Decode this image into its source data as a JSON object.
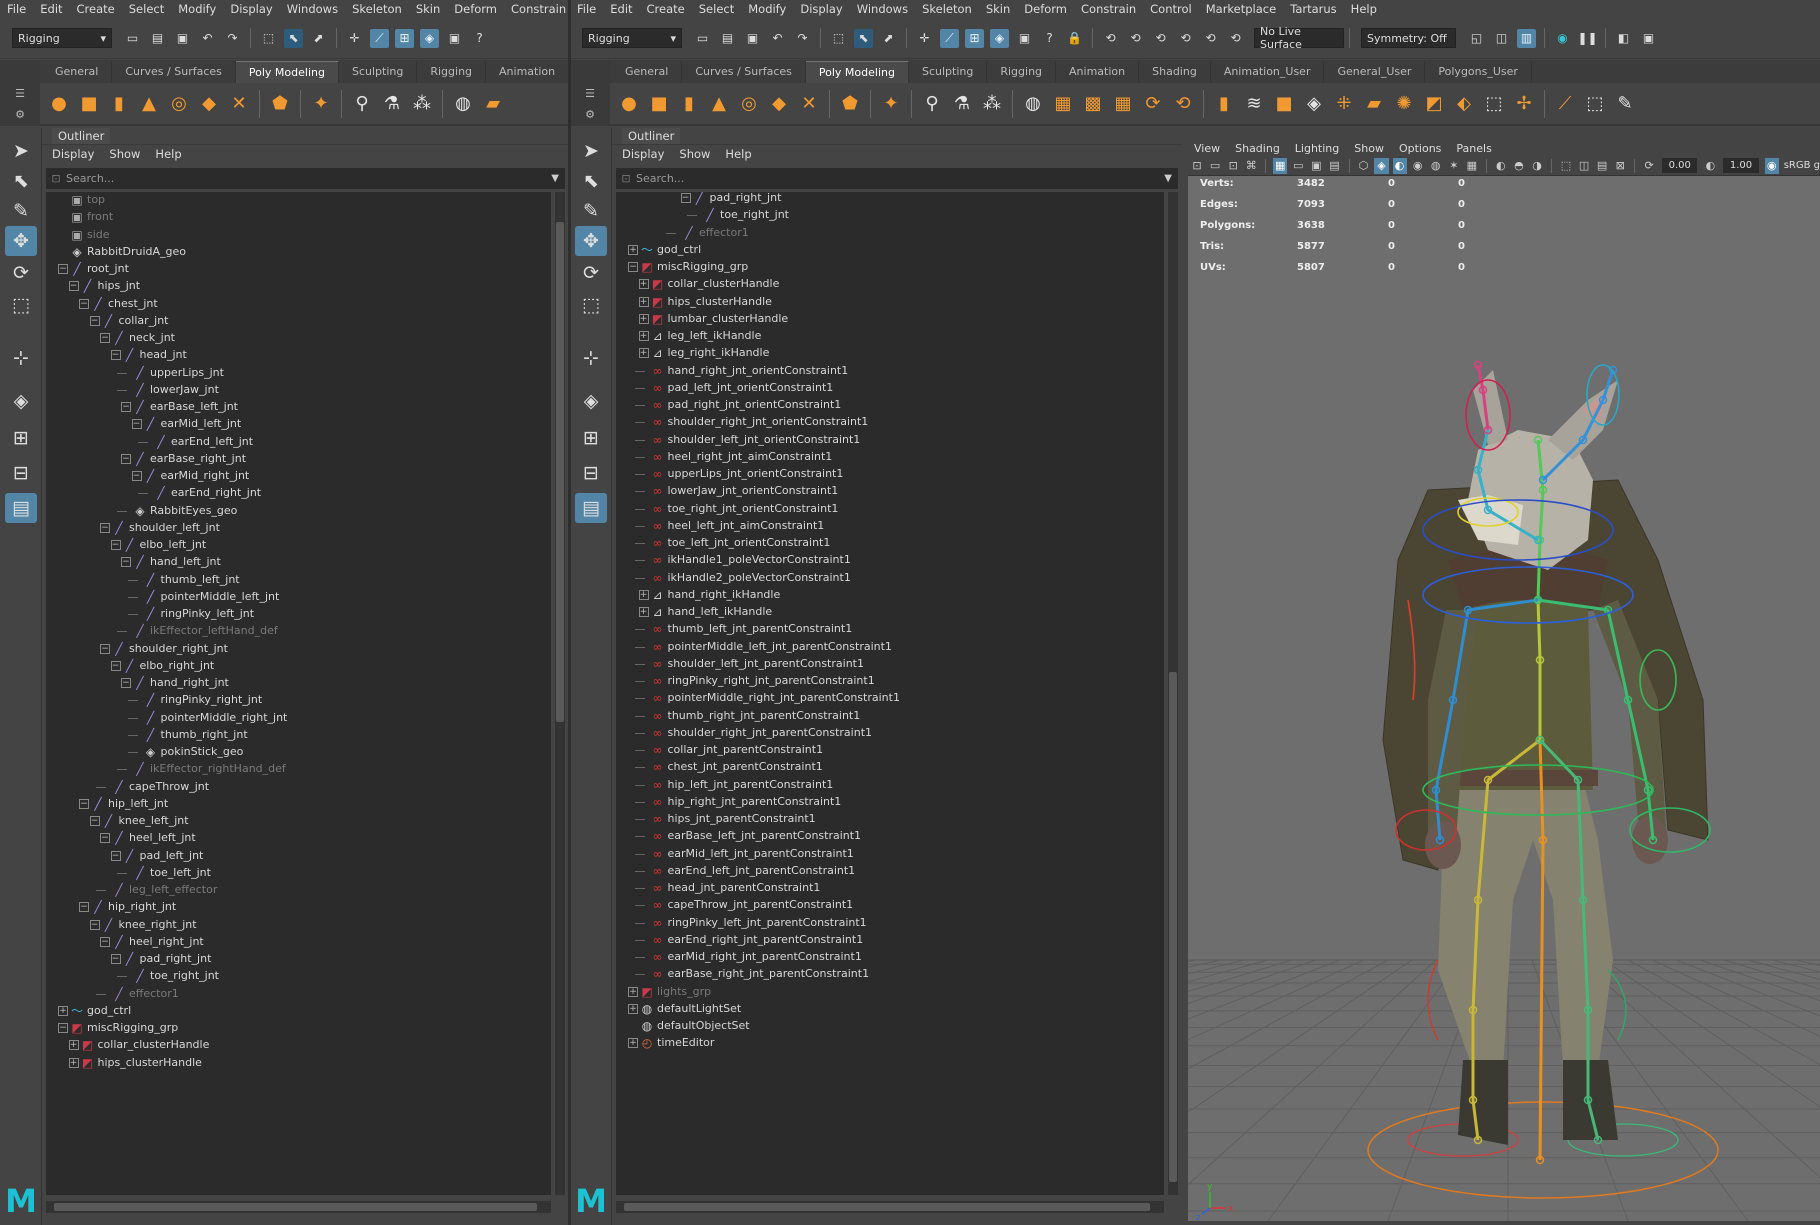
{
  "menus": [
    "File",
    "Edit",
    "Create",
    "Select",
    "Modify",
    "Display",
    "Windows",
    "Skeleton",
    "Skin",
    "Deform",
    "Constrain",
    "Control",
    "Marketplace",
    "Tartarus",
    "Help"
  ],
  "menus_left_visible": [
    "File",
    "Edit",
    "Create",
    "Select",
    "Modify",
    "Display",
    "Windows",
    "Skeleton",
    "Skin",
    "Deform",
    "Constrain",
    "Co"
  ],
  "menu_set": "Rigging",
  "live_surface": "No Live Surface",
  "symmetry": "Symmetry: Off",
  "shelf_tabs_left": [
    "General",
    "Curves / Surfaces",
    "Poly Modeling",
    "Sculpting",
    "Rigging",
    "Animation"
  ],
  "shelf_tabs_right": [
    "General",
    "Curves / Surfaces",
    "Poly Modeling",
    "Sculpting",
    "Rigging",
    "Animation",
    "Shading",
    "Animation_User",
    "General_User",
    "Polygons_User"
  ],
  "active_shelf_tab": "Poly Modeling",
  "outliner": {
    "title": "Outliner",
    "menu": [
      "Display",
      "Show",
      "Help"
    ],
    "search_placeholder": "Search..."
  },
  "left_tree": [
    {
      "label": "top",
      "icon": "cam",
      "depth": 1,
      "dim": true
    },
    {
      "label": "front",
      "icon": "cam",
      "depth": 1,
      "dim": true
    },
    {
      "label": "side",
      "icon": "cam",
      "depth": 1,
      "dim": true
    },
    {
      "label": "RabbitDruidA_geo",
      "icon": "mesh",
      "depth": 1
    },
    {
      "label": "root_jnt",
      "icon": "joint",
      "depth": 1,
      "exp": "-"
    },
    {
      "label": "hips_jnt",
      "icon": "joint",
      "depth": 2,
      "exp": "-"
    },
    {
      "label": "chest_jnt",
      "icon": "joint",
      "depth": 3,
      "exp": "-"
    },
    {
      "label": "collar_jnt",
      "icon": "joint",
      "depth": 4,
      "exp": "-"
    },
    {
      "label": "neck_jnt",
      "icon": "joint",
      "depth": 5,
      "exp": "-"
    },
    {
      "label": "head_jnt",
      "icon": "joint",
      "depth": 6,
      "exp": "-"
    },
    {
      "label": "upperLips_jnt",
      "icon": "joint",
      "depth": 7
    },
    {
      "label": "lowerJaw_jnt",
      "icon": "joint",
      "depth": 7
    },
    {
      "label": "earBase_left_jnt",
      "icon": "joint",
      "depth": 7,
      "exp": "-"
    },
    {
      "label": "earMid_left_jnt",
      "icon": "joint",
      "depth": 8,
      "exp": "-"
    },
    {
      "label": "earEnd_left_jnt",
      "icon": "joint",
      "depth": 9
    },
    {
      "label": "earBase_right_jnt",
      "icon": "joint",
      "depth": 7,
      "exp": "-"
    },
    {
      "label": "earMid_right_jnt",
      "icon": "joint",
      "depth": 8,
      "exp": "-"
    },
    {
      "label": "earEnd_right_jnt",
      "icon": "joint",
      "depth": 9
    },
    {
      "label": "RabbitEyes_geo",
      "icon": "mesh",
      "depth": 7
    },
    {
      "label": "shoulder_left_jnt",
      "icon": "joint",
      "depth": 5,
      "exp": "-"
    },
    {
      "label": "elbo_left_jnt",
      "icon": "joint",
      "depth": 6,
      "exp": "-"
    },
    {
      "label": "hand_left_jnt",
      "icon": "joint",
      "depth": 7,
      "exp": "-"
    },
    {
      "label": "thumb_left_jnt",
      "icon": "joint",
      "depth": 8
    },
    {
      "label": "pointerMiddle_left_jnt",
      "icon": "joint",
      "depth": 8
    },
    {
      "label": "ringPinky_left_jnt",
      "icon": "joint",
      "depth": 8
    },
    {
      "label": "ikEffector_leftHand_def",
      "icon": "eff",
      "depth": 7,
      "dim": true
    },
    {
      "label": "shoulder_right_jnt",
      "icon": "joint",
      "depth": 5,
      "exp": "-"
    },
    {
      "label": "elbo_right_jnt",
      "icon": "joint",
      "depth": 6,
      "exp": "-"
    },
    {
      "label": "hand_right_jnt",
      "icon": "joint",
      "depth": 7,
      "exp": "-"
    },
    {
      "label": "ringPinky_right_jnt",
      "icon": "joint",
      "depth": 8
    },
    {
      "label": "pointerMiddle_right_jnt",
      "icon": "joint",
      "depth": 8
    },
    {
      "label": "thumb_right_jnt",
      "icon": "joint",
      "depth": 8
    },
    {
      "label": "pokinStick_geo",
      "icon": "mesh",
      "depth": 8
    },
    {
      "label": "ikEffector_rightHand_def",
      "icon": "eff",
      "depth": 7,
      "dim": true
    },
    {
      "label": "capeThrow_jnt",
      "icon": "joint",
      "depth": 5
    },
    {
      "label": "hip_left_jnt",
      "icon": "joint",
      "depth": 3,
      "exp": "-"
    },
    {
      "label": "knee_left_jnt",
      "icon": "joint",
      "depth": 4,
      "exp": "-"
    },
    {
      "label": "heel_left_jnt",
      "icon": "joint",
      "depth": 5,
      "exp": "-"
    },
    {
      "label": "pad_left_jnt",
      "icon": "joint",
      "depth": 6,
      "exp": "-"
    },
    {
      "label": "toe_left_jnt",
      "icon": "joint",
      "depth": 7
    },
    {
      "label": "leg_left_effector",
      "icon": "eff",
      "depth": 5,
      "dim": true
    },
    {
      "label": "hip_right_jnt",
      "icon": "joint",
      "depth": 3,
      "exp": "-"
    },
    {
      "label": "knee_right_jnt",
      "icon": "joint",
      "depth": 4,
      "exp": "-"
    },
    {
      "label": "heel_right_jnt",
      "icon": "joint",
      "depth": 5,
      "exp": "-"
    },
    {
      "label": "pad_right_jnt",
      "icon": "joint",
      "depth": 6,
      "exp": "-"
    },
    {
      "label": "toe_right_jnt",
      "icon": "joint",
      "depth": 7
    },
    {
      "label": "effector1",
      "icon": "eff",
      "depth": 5,
      "dim": true
    },
    {
      "label": "god_ctrl",
      "icon": "curve",
      "depth": 1,
      "exp": "+"
    },
    {
      "label": "miscRigging_grp",
      "icon": "grp",
      "depth": 1,
      "exp": "-"
    },
    {
      "label": "collar_clusterHandle",
      "icon": "grp",
      "depth": 2,
      "exp": "+"
    },
    {
      "label": "hips_clusterHandle",
      "icon": "grp",
      "depth": 2,
      "exp": "+"
    }
  ],
  "right_tree": [
    {
      "label": "pad_right_jnt",
      "icon": "joint",
      "depth": 6,
      "exp": "-"
    },
    {
      "label": "toe_right_jnt",
      "icon": "joint",
      "depth": 7
    },
    {
      "label": "effector1",
      "icon": "eff",
      "depth": 5,
      "dim": true
    },
    {
      "label": "god_ctrl",
      "icon": "curve",
      "depth": 1,
      "exp": "+"
    },
    {
      "label": "miscRigging_grp",
      "icon": "grp",
      "depth": 1,
      "exp": "-"
    },
    {
      "label": "collar_clusterHandle",
      "icon": "grp",
      "depth": 2,
      "exp": "+"
    },
    {
      "label": "hips_clusterHandle",
      "icon": "grp",
      "depth": 2,
      "exp": "+"
    },
    {
      "label": "lumbar_clusterHandle",
      "icon": "grp",
      "depth": 2,
      "exp": "+"
    },
    {
      "label": "leg_left_ikHandle",
      "icon": "handle",
      "depth": 2,
      "exp": "+"
    },
    {
      "label": "leg_right_ikHandle",
      "icon": "handle",
      "depth": 2,
      "exp": "+"
    },
    {
      "label": "hand_right_jnt_orientConstraint1",
      "icon": "cons",
      "depth": 2
    },
    {
      "label": "pad_left_jnt_orientConstraint1",
      "icon": "cons",
      "depth": 2
    },
    {
      "label": "pad_right_jnt_orientConstraint1",
      "icon": "cons",
      "depth": 2
    },
    {
      "label": "shoulder_right_jnt_orientConstraint1",
      "icon": "cons",
      "depth": 2
    },
    {
      "label": "shoulder_left_jnt_orientConstraint1",
      "icon": "cons",
      "depth": 2
    },
    {
      "label": "heel_right_jnt_aimConstraint1",
      "icon": "cons",
      "depth": 2
    },
    {
      "label": "upperLips_jnt_orientConstraint1",
      "icon": "cons",
      "depth": 2
    },
    {
      "label": "lowerJaw_jnt_orientConstraint1",
      "icon": "cons",
      "depth": 2
    },
    {
      "label": "toe_right_jnt_orientConstraint1",
      "icon": "cons",
      "depth": 2
    },
    {
      "label": "heel_left_jnt_aimConstraint1",
      "icon": "cons",
      "depth": 2
    },
    {
      "label": "toe_left_jnt_orientConstraint1",
      "icon": "cons",
      "depth": 2
    },
    {
      "label": "ikHandle1_poleVectorConstraint1",
      "icon": "cons",
      "depth": 2
    },
    {
      "label": "ikHandle2_poleVectorConstraint1",
      "icon": "cons",
      "depth": 2
    },
    {
      "label": "hand_right_ikHandle",
      "icon": "handle",
      "depth": 2,
      "exp": "+"
    },
    {
      "label": "hand_left_ikHandle",
      "icon": "handle",
      "depth": 2,
      "exp": "+"
    },
    {
      "label": "thumb_left_jnt_parentConstraint1",
      "icon": "cons",
      "depth": 2
    },
    {
      "label": "pointerMiddle_left_jnt_parentConstraint1",
      "icon": "cons",
      "depth": 2
    },
    {
      "label": "shoulder_left_jnt_parentConstraint1",
      "icon": "cons",
      "depth": 2
    },
    {
      "label": "ringPinky_right_jnt_parentConstraint1",
      "icon": "cons",
      "depth": 2
    },
    {
      "label": "pointerMiddle_right_jnt_parentConstraint1",
      "icon": "cons",
      "depth": 2
    },
    {
      "label": "thumb_right_jnt_parentConstraint1",
      "icon": "cons",
      "depth": 2
    },
    {
      "label": "shoulder_right_jnt_parentConstraint1",
      "icon": "cons",
      "depth": 2
    },
    {
      "label": "collar_jnt_parentConstraint1",
      "icon": "cons",
      "depth": 2
    },
    {
      "label": "chest_jnt_parentConstraint1",
      "icon": "cons",
      "depth": 2
    },
    {
      "label": "hip_left_jnt_parentConstraint1",
      "icon": "cons",
      "depth": 2
    },
    {
      "label": "hip_right_jnt_parentConstraint1",
      "icon": "cons",
      "depth": 2
    },
    {
      "label": "hips_jnt_parentConstraint1",
      "icon": "cons",
      "depth": 2
    },
    {
      "label": "earBase_left_jnt_parentConstraint1",
      "icon": "cons",
      "depth": 2
    },
    {
      "label": "earMid_left_jnt_parentConstraint1",
      "icon": "cons",
      "depth": 2
    },
    {
      "label": "earEnd_left_jnt_parentConstraint1",
      "icon": "cons",
      "depth": 2
    },
    {
      "label": "head_jnt_parentConstraint1",
      "icon": "cons",
      "depth": 2
    },
    {
      "label": "capeThrow_jnt_parentConstraint1",
      "icon": "cons",
      "depth": 2
    },
    {
      "label": "ringPinky_left_jnt_parentConstraint1",
      "icon": "cons",
      "depth": 2
    },
    {
      "label": "earEnd_right_jnt_parentConstraint1",
      "icon": "cons",
      "depth": 2
    },
    {
      "label": "earMid_right_jnt_parentConstraint1",
      "icon": "cons",
      "depth": 2
    },
    {
      "label": "earBase_right_jnt_parentConstraint1",
      "icon": "cons",
      "depth": 2
    },
    {
      "label": "lights_grp",
      "icon": "grp",
      "depth": 1,
      "exp": "+",
      "dim": true
    },
    {
      "label": "defaultLightSet",
      "icon": "set",
      "depth": 1,
      "exp": "+"
    },
    {
      "label": "defaultObjectSet",
      "icon": "set",
      "depth": 1
    },
    {
      "label": "timeEditor",
      "icon": "time",
      "depth": 1,
      "exp": "+"
    }
  ],
  "viewport": {
    "menu": [
      "View",
      "Shading",
      "Lighting",
      "Show",
      "Options",
      "Panels"
    ],
    "exposure": "0.00",
    "gamma": "1.00",
    "colorspace": "sRGB g",
    "hud": [
      {
        "label": "Verts:",
        "v1": "3482",
        "v2": "0",
        "v3": "0"
      },
      {
        "label": "Edges:",
        "v1": "7093",
        "v2": "0",
        "v3": "0"
      },
      {
        "label": "Polygons:",
        "v1": "3638",
        "v2": "0",
        "v3": "0"
      },
      {
        "label": "Tris:",
        "v1": "5877",
        "v2": "0",
        "v3": "0"
      },
      {
        "label": "UVs:",
        "v1": "5807",
        "v2": "0",
        "v3": "0"
      }
    ],
    "axis_x": "x",
    "axis_y": "y",
    "axis_z": "z"
  },
  "logo_letter": "M"
}
